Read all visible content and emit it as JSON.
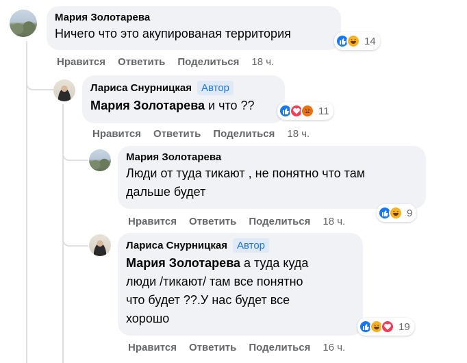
{
  "comments": [
    {
      "author": "Мария Золотарева",
      "text": "Ничего что это акупированая территория",
      "reactions": [
        "like",
        "haha"
      ],
      "reaction_count": "14",
      "actions": {
        "like": "Нравится",
        "reply": "Ответить",
        "share": "Поделиться",
        "time": "18 ч."
      }
    },
    {
      "author": "Лариса Снурницкая",
      "badge": "Автор",
      "mention": "Мария Золотарева",
      "text": " и что ??",
      "reactions": [
        "like",
        "love",
        "angry"
      ],
      "reaction_count": "11",
      "actions": {
        "like": "Нравится",
        "reply": "Ответить",
        "share": "Поделиться",
        "time": "18 ч."
      }
    },
    {
      "author": "Мария Золотарева",
      "text_line1": "Люди от туда тикают , не понятно что там",
      "text_line2": "дальше будет",
      "reactions": [
        "like",
        "haha"
      ],
      "reaction_count": "9",
      "actions": {
        "like": "Нравится",
        "reply": "Ответить",
        "share": "Поделиться",
        "time": "18 ч."
      }
    },
    {
      "author": "Лариса Снурницкая",
      "badge": "Автор",
      "mention": "Мария Золотарева",
      "text_line1": " а туда куда",
      "text_line2": "люди /тикают/ там все понятно",
      "text_line3": "что будет ??.У нас будет все",
      "text_line4": "хорошо",
      "reactions": [
        "like",
        "haha",
        "love"
      ],
      "reaction_count": "19",
      "actions": {
        "like": "Нравится",
        "reply": "Ответить",
        "share": "Поделиться",
        "time": "16 ч."
      }
    }
  ]
}
